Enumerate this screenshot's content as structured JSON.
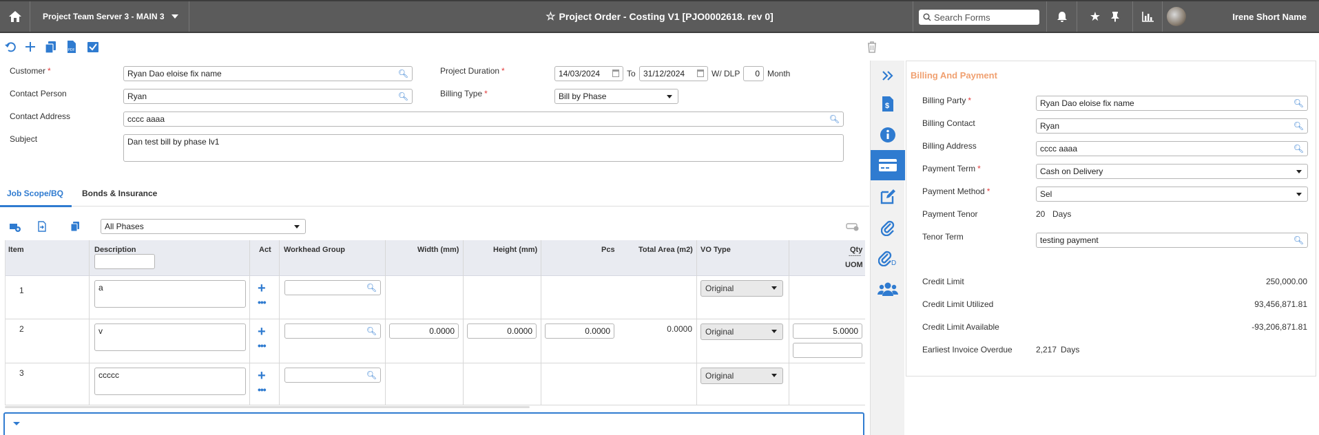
{
  "topbar": {
    "server": "Project Team Server 3 - MAIN 3",
    "title": "Project Order - Costing V1 [PJO0002618. rev 0]",
    "search_placeholder": "Search Forms",
    "user_name": "Irene Short Name"
  },
  "form": {
    "customer_label": "Customer",
    "customer_value": "Ryan Dao eloise fix name",
    "contact_person_label": "Contact Person",
    "contact_person_value": "Ryan",
    "contact_address_label": "Contact Address",
    "contact_address_value": "cccc aaaa",
    "subject_label": "Subject",
    "subject_value": "Dan test bill by phase lv1",
    "project_duration_label": "Project Duration",
    "date_from": "14/03/2024",
    "to_label": "To",
    "date_to": "31/12/2024",
    "wdlp_label": "W/ DLP",
    "wdlp_value": "0",
    "month_label": "Month",
    "billing_type_label": "Billing Type",
    "billing_type_value": "Bill by Phase"
  },
  "tabs": [
    "Job Scope/BQ",
    "Bonds & Insurance"
  ],
  "phase_filter": "All Phases",
  "grid": {
    "headers": {
      "item": "Item",
      "description": "Description",
      "act": "Act",
      "workhead": "Workhead Group",
      "width": "Width (mm)",
      "height": "Height (mm)",
      "pcs": "Pcs",
      "total_area": "Total Area (m2)",
      "vo_type": "VO Type",
      "qty": "Qty",
      "qty_sep": "------",
      "uom": "UOM"
    },
    "rows": [
      {
        "item": "1",
        "description": "a",
        "width": "",
        "height": "",
        "pcs": "",
        "total_area": "",
        "vo_type": "Original",
        "qty": ""
      },
      {
        "item": "2",
        "description": "v",
        "width": "0.0000",
        "height": "0.0000",
        "pcs": "0.0000",
        "total_area": "0.0000",
        "vo_type": "Original",
        "qty": "5.0000"
      },
      {
        "item": "3",
        "description": "ccccc",
        "width": "",
        "height": "",
        "pcs": "",
        "total_area": "",
        "vo_type": "Original",
        "qty": ""
      }
    ]
  },
  "panel": {
    "title": "Billing And Payment",
    "billing_party_label": "Billing Party",
    "billing_party_value": "Ryan Dao eloise fix name",
    "billing_contact_label": "Billing Contact",
    "billing_contact_value": "Ryan",
    "billing_address_label": "Billing Address",
    "billing_address_value": "cccc aaaa",
    "payment_term_label": "Payment Term",
    "payment_term_value": "Cash on Delivery",
    "payment_method_label": "Payment Method",
    "payment_method_value": "Sel",
    "payment_tenor_label": "Payment Tenor",
    "payment_tenor_value": "20",
    "days_label": "Days",
    "tenor_term_label": "Tenor Term",
    "tenor_term_value": "testing payment",
    "credit_limit_label": "Credit Limit",
    "credit_limit_value": "250,000.00",
    "credit_used_label": "Credit Limit Utilized",
    "credit_used_value": "93,456,871.81",
    "credit_avail_label": "Credit Limit Available",
    "credit_avail_value": "-93,206,871.81",
    "overdue_label": "Earliest Invoice Overdue",
    "overdue_value": "2,217",
    "overdue_days": "Days"
  }
}
